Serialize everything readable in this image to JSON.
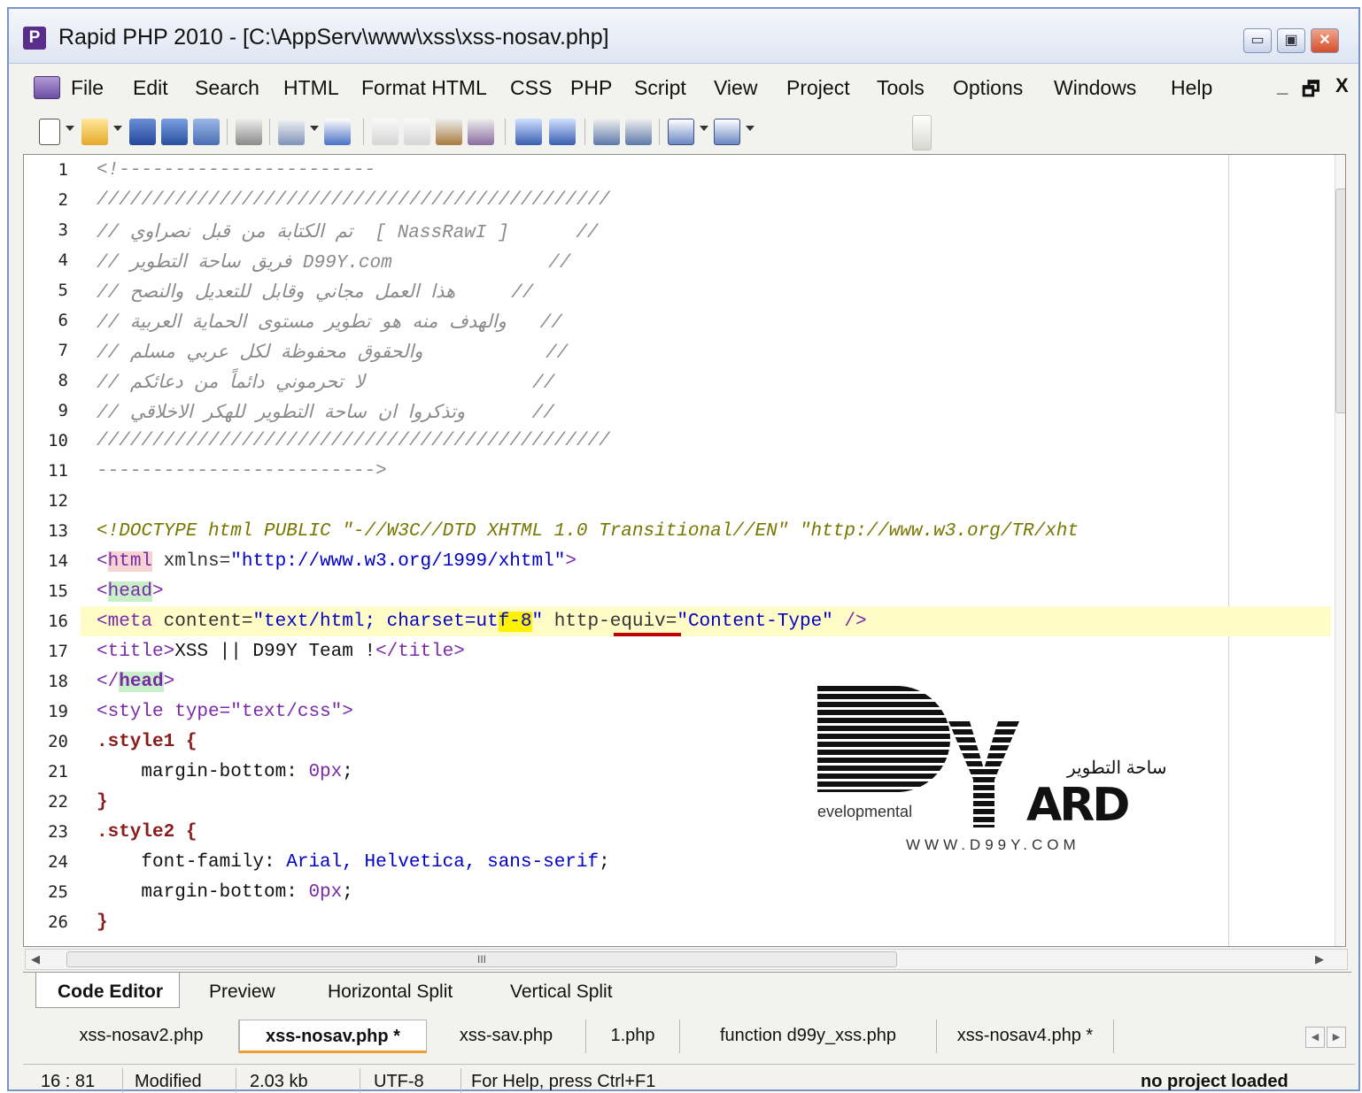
{
  "window": {
    "title": "Rapid PHP 2010 - [C:\\AppServ\\www\\xss\\xss-nosav.php]",
    "app_icon_letter": "P"
  },
  "caption_buttons": {
    "minimize": "▭",
    "restore": "▣",
    "close": "✕"
  },
  "menu": {
    "items": [
      "File",
      "Edit",
      "Search",
      "HTML",
      "Format HTML",
      "CSS",
      "PHP",
      "Script",
      "View",
      "Project",
      "Tools",
      "Options",
      "Windows",
      "Help"
    ],
    "mdi_controls": {
      "minimize": "_",
      "restore": "🗗",
      "close": "X"
    }
  },
  "toolbar": {
    "icons": [
      "new-file-icon",
      "open-folder-icon",
      "save-icon",
      "save-all-icon",
      "save-copy-icon",
      "print-icon",
      "print-preview-icon",
      "spell-check-icon",
      "cut-icon",
      "copy-icon",
      "paste-icon",
      "paste-special-icon",
      "undo-icon",
      "redo-icon",
      "indent-icon",
      "outdent-icon",
      "window-icon",
      "layout-icon"
    ]
  },
  "editor": {
    "line_numbers": [
      "1",
      "2",
      "3",
      "4",
      "5",
      "6",
      "7",
      "8",
      "9",
      "10",
      "11",
      "12",
      "13",
      "14",
      "15",
      "16",
      "17",
      "18",
      "19",
      "20",
      "21",
      "22",
      "23",
      "24",
      "25",
      "26"
    ],
    "lines": {
      "l1": "<!-----------------------",
      "l2": "//////////////////////////////////////////////",
      "l3": "// تم الكتابة من قبل نصراوي  [ NassRawI ]      //",
      "l4": "// فريق ساحة التطوير D99Y.com              //",
      "l5": "// هذا العمل مجاني وقابل للتعديل والنصح     //",
      "l6": "// والهدف منه هو تطوير مستوى الحماية العربية   //",
      "l7": "// والحقوق محفوظة لكل عربي مسلم           //",
      "l8": "// لا تحرموني دائماً من دعائكم               //",
      "l9": "// وتذكروا ان ساحة التطوير للهكر الاخلاقي      //",
      "l10": "//////////////////////////////////////////////",
      "l11": "------------------------->",
      "l13": "<!DOCTYPE html PUBLIC \"-//W3C//DTD XHTML 1.0 Transitional//EN\" \"http://www.w3.org/TR/xht",
      "l14_tag": "html",
      "l14_attr": " xmlns=",
      "l14_val": "\"http://www.w3.org/1999/xhtml\"",
      "l15_tag": "head",
      "l16_open": "<meta",
      "l16_attr1": " content=",
      "l16_val1a": "\"text/html; charset=ut",
      "l16_val1b": "f-8",
      "l16_val1c": "\"",
      "l16_attr2": " http-equiv=",
      "l16_val2": "\"Content-Type\"",
      "l16_close": " />",
      "l17_open": "<title>",
      "l17_text": "XSS || D99Y Team !",
      "l17_close": "</title>",
      "l18_tag": "head",
      "l19_open": "<style",
      "l19_attr": " type=",
      "l19_val": "\"text/css\"",
      "l20": ".style1 {",
      "l21_prop": "    margin-bottom: ",
      "l21_val": "0px",
      "l22": "}",
      "l23": ".style2 {",
      "l24_prop": "    font-family: ",
      "l24_val": "Arial, Helvetica, sans-serif",
      "l25_prop": "    margin-bottom: ",
      "l25_val": "0px",
      "l26": "}"
    }
  },
  "watermark": {
    "letters": "ARD",
    "arabic": "ساحة التطوير",
    "tagline": "evelopmental",
    "url": "WWW.D99Y.COM"
  },
  "hscroll": {
    "thumb_grip": "III",
    "left": "◀",
    "right": "▶"
  },
  "view_tabs": [
    "Code Editor",
    "Preview",
    "Horizontal Split",
    "Vertical Split"
  ],
  "file_tabs": [
    "xss-nosav2.php",
    "xss-nosav.php *",
    "xss-sav.php",
    "1.php",
    "function d99y_xss.php",
    "xss-nosav4.php *"
  ],
  "status": {
    "position": "16 : 81",
    "modified": "Modified",
    "size": "2.03 kb",
    "encoding": "UTF-8",
    "help": "For Help, press Ctrl+F1",
    "project": "no project loaded"
  }
}
